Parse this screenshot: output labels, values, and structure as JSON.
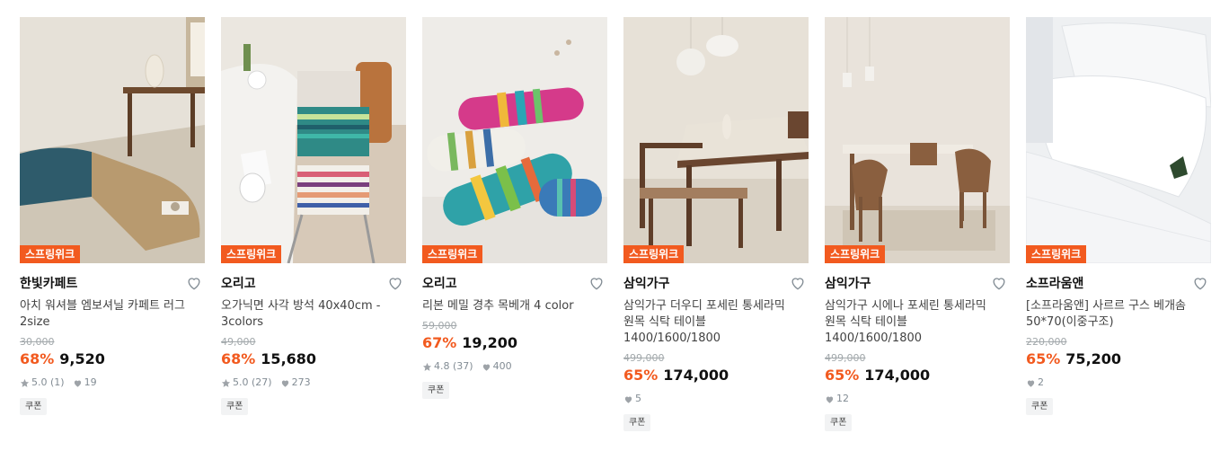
{
  "badge_label": "스프링위크",
  "coupon_label": "쿠폰",
  "icons": {
    "wishlist": "heart-outline-icon",
    "rating": "star-icon",
    "likes": "heart-filled-icon"
  },
  "colors": {
    "accent": "#f25a1f",
    "muted": "#828c94"
  },
  "products": [
    {
      "brand": "한빛카페트",
      "name": "아치 워셔블 엠보셔닐 카페트 러그 2size",
      "original_price": "30,000",
      "discount": "68%",
      "price": "9,520",
      "rating": "5.0",
      "reviews": "(1)",
      "likes": "19"
    },
    {
      "brand": "오리고",
      "name": "오가닉면 사각 방석 40x40cm - 3colors",
      "original_price": "49,000",
      "discount": "68%",
      "price": "15,680",
      "rating": "5.0",
      "reviews": "(27)",
      "likes": "273"
    },
    {
      "brand": "오리고",
      "name": "리본 메밀 경추 목베개 4 color",
      "original_price": "59,000",
      "discount": "67%",
      "price": "19,200",
      "rating": "4.8",
      "reviews": "(37)",
      "likes": "400"
    },
    {
      "brand": "삼익가구",
      "name": "삼익가구 더우디 포세린 통세라믹 원목 식탁 테이블 1400/1600/1800",
      "original_price": "499,000",
      "discount": "65%",
      "price": "174,000",
      "likes": "5"
    },
    {
      "brand": "삼익가구",
      "name": "삼익가구 시에나 포세린 통세라믹 원목 식탁 테이블 1400/1600/1800",
      "original_price": "499,000",
      "discount": "65%",
      "price": "174,000",
      "likes": "12"
    },
    {
      "brand": "소프라움앤",
      "name": "[소프라움앤] 사르르 구스 베개솜 50*70(이중구조)",
      "original_price": "220,000",
      "discount": "65%",
      "price": "75,200",
      "likes": "2"
    }
  ]
}
